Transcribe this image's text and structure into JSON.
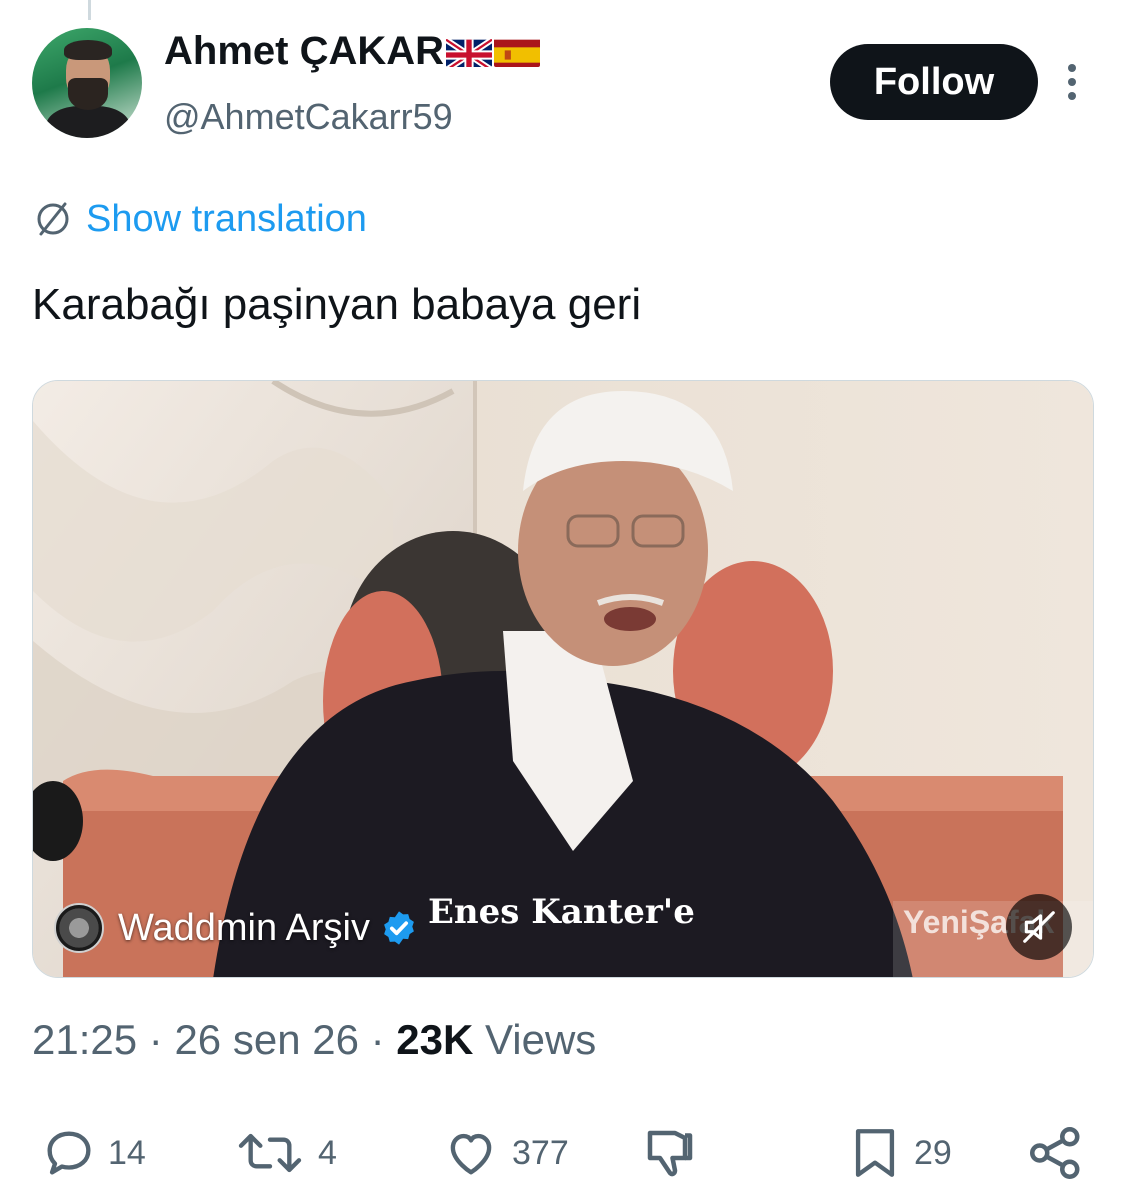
{
  "author": {
    "display_name": "Ahmet ÇAKAR",
    "handle": "@AhmetCakarr59",
    "flags": [
      "uk-flag",
      "spain-flag"
    ]
  },
  "header": {
    "follow_label": "Follow",
    "more_icon": "more-vertical-icon"
  },
  "translation": {
    "label": "Show translation",
    "icon": "translate-globe-icon"
  },
  "tweet": {
    "text": "Karabağı paşinyan babaya geri"
  },
  "media": {
    "type": "video",
    "caption_overlay": "Enes Kanter'e",
    "watermark": "YeniŞafak",
    "source_name": "Waddmin Arşiv",
    "source_verified": true,
    "muted": true
  },
  "meta": {
    "time": "21:25",
    "separator": "·",
    "date": "26 sen 26",
    "views_count": "23K",
    "views_label": "Views"
  },
  "actions": {
    "replies": "14",
    "reposts": "4",
    "likes": "377",
    "bookmarks": "29"
  },
  "colors": {
    "accent": "#1d9bf0",
    "text_primary": "#0f1419",
    "text_secondary": "#536471",
    "button_bg": "#0f1419"
  }
}
